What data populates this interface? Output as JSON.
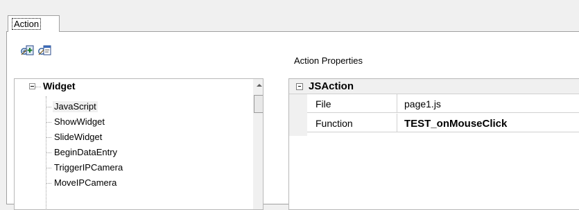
{
  "tabs": [
    {
      "label": "Action"
    }
  ],
  "toolbar": {
    "icons": [
      "add-action-icon",
      "edit-action-icon"
    ]
  },
  "tree": {
    "root_label": "Widget",
    "items": [
      {
        "label": "JavaScript"
      },
      {
        "label": "ShowWidget"
      },
      {
        "label": "SlideWidget"
      },
      {
        "label": "BeginDataEntry"
      },
      {
        "label": "TriggerIPCamera"
      },
      {
        "label": "MoveIPCamera"
      }
    ]
  },
  "properties": {
    "heading": "Action Properties",
    "category": "JSAction",
    "rows": [
      {
        "name": "File",
        "value": "page1.js"
      },
      {
        "name": "Function",
        "value": "TEST_onMouseClick"
      }
    ]
  }
}
